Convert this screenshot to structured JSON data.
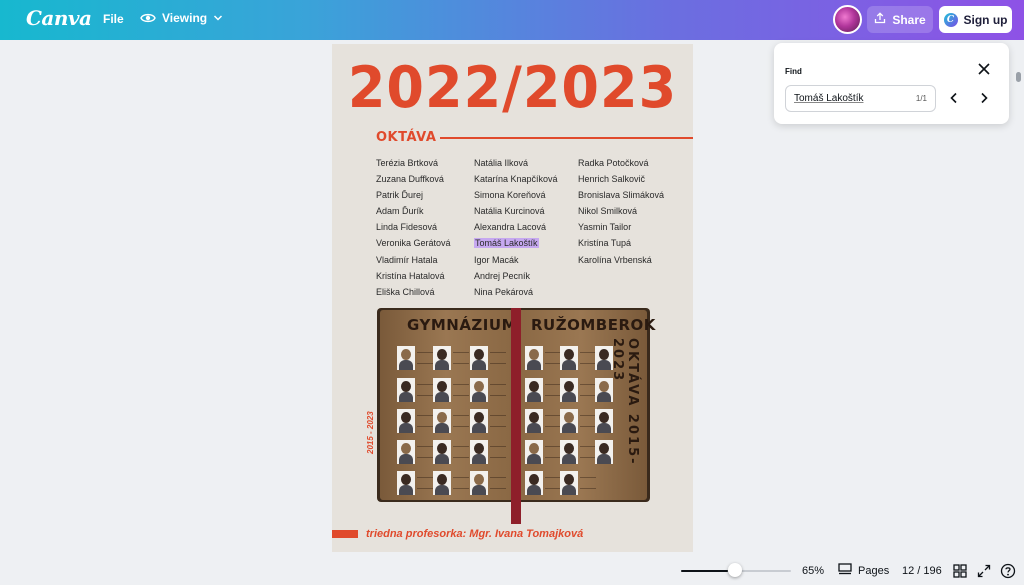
{
  "topbar": {
    "logo": "Canva",
    "file_label": "File",
    "viewing_label": "Viewing",
    "share_label": "Share",
    "signup_label": "Sign up",
    "signup_badge": "C"
  },
  "document": {
    "year": "2022/2023",
    "class_title": "OKTÁVA",
    "columns": [
      [
        "Terézia Brtková",
        "Zuzana Duffková",
        "Patrik Ďurej",
        "Adam Ďurík",
        "Linda Fidesová",
        "Veronika Gerátová",
        "Vladimír Hatala",
        "Kristína Hatalová",
        "Eliška Chillová"
      ],
      [
        "Natália Ilková",
        "Katarína Knapčíková",
        "Simona Koreňová",
        "Natália Kurcinová",
        "Alexandra Lacová",
        "Tomáš Lakoštík",
        "Igor Macák",
        "Andrej Pecník",
        "Nina Pekárová"
      ],
      [
        "Radka Potočková",
        "Henrich Salkovič",
        "Bronislava Slimáková",
        "Nikol Smilková",
        "Yasmin Tailor",
        "Kristína Tupá",
        "Karolína Vrbenská"
      ]
    ],
    "highlighted_name": "Tomáš Lakoštík",
    "book_heading_left": "GYMNÁZIUM",
    "book_heading_right": "RUŽOMBEROK",
    "book_vertical_text": "OKTÁVA 2015-2023",
    "side_years": "2015 - 2023",
    "teacher_line": "triedna profesorka:  Mgr. Ivana Tomajková"
  },
  "find": {
    "title": "Find",
    "query": "Tomáš Lakoštík",
    "count": "1/1"
  },
  "footer": {
    "zoom_percent": 65,
    "zoom_label": "65%",
    "pages_label": "Pages",
    "page_count": "12 / 196"
  },
  "colors": {
    "accent_red": "#e04a2c",
    "highlight": "#c6a8f0",
    "gradient_start": "#17b8cf",
    "gradient_end": "#8e52e6"
  },
  "icons": [
    "eye-icon",
    "chevron-down-icon",
    "upload-icon",
    "close-icon",
    "chevron-left-icon",
    "chevron-right-icon",
    "pages-icon",
    "grid-icon",
    "expand-icon",
    "help-icon"
  ]
}
